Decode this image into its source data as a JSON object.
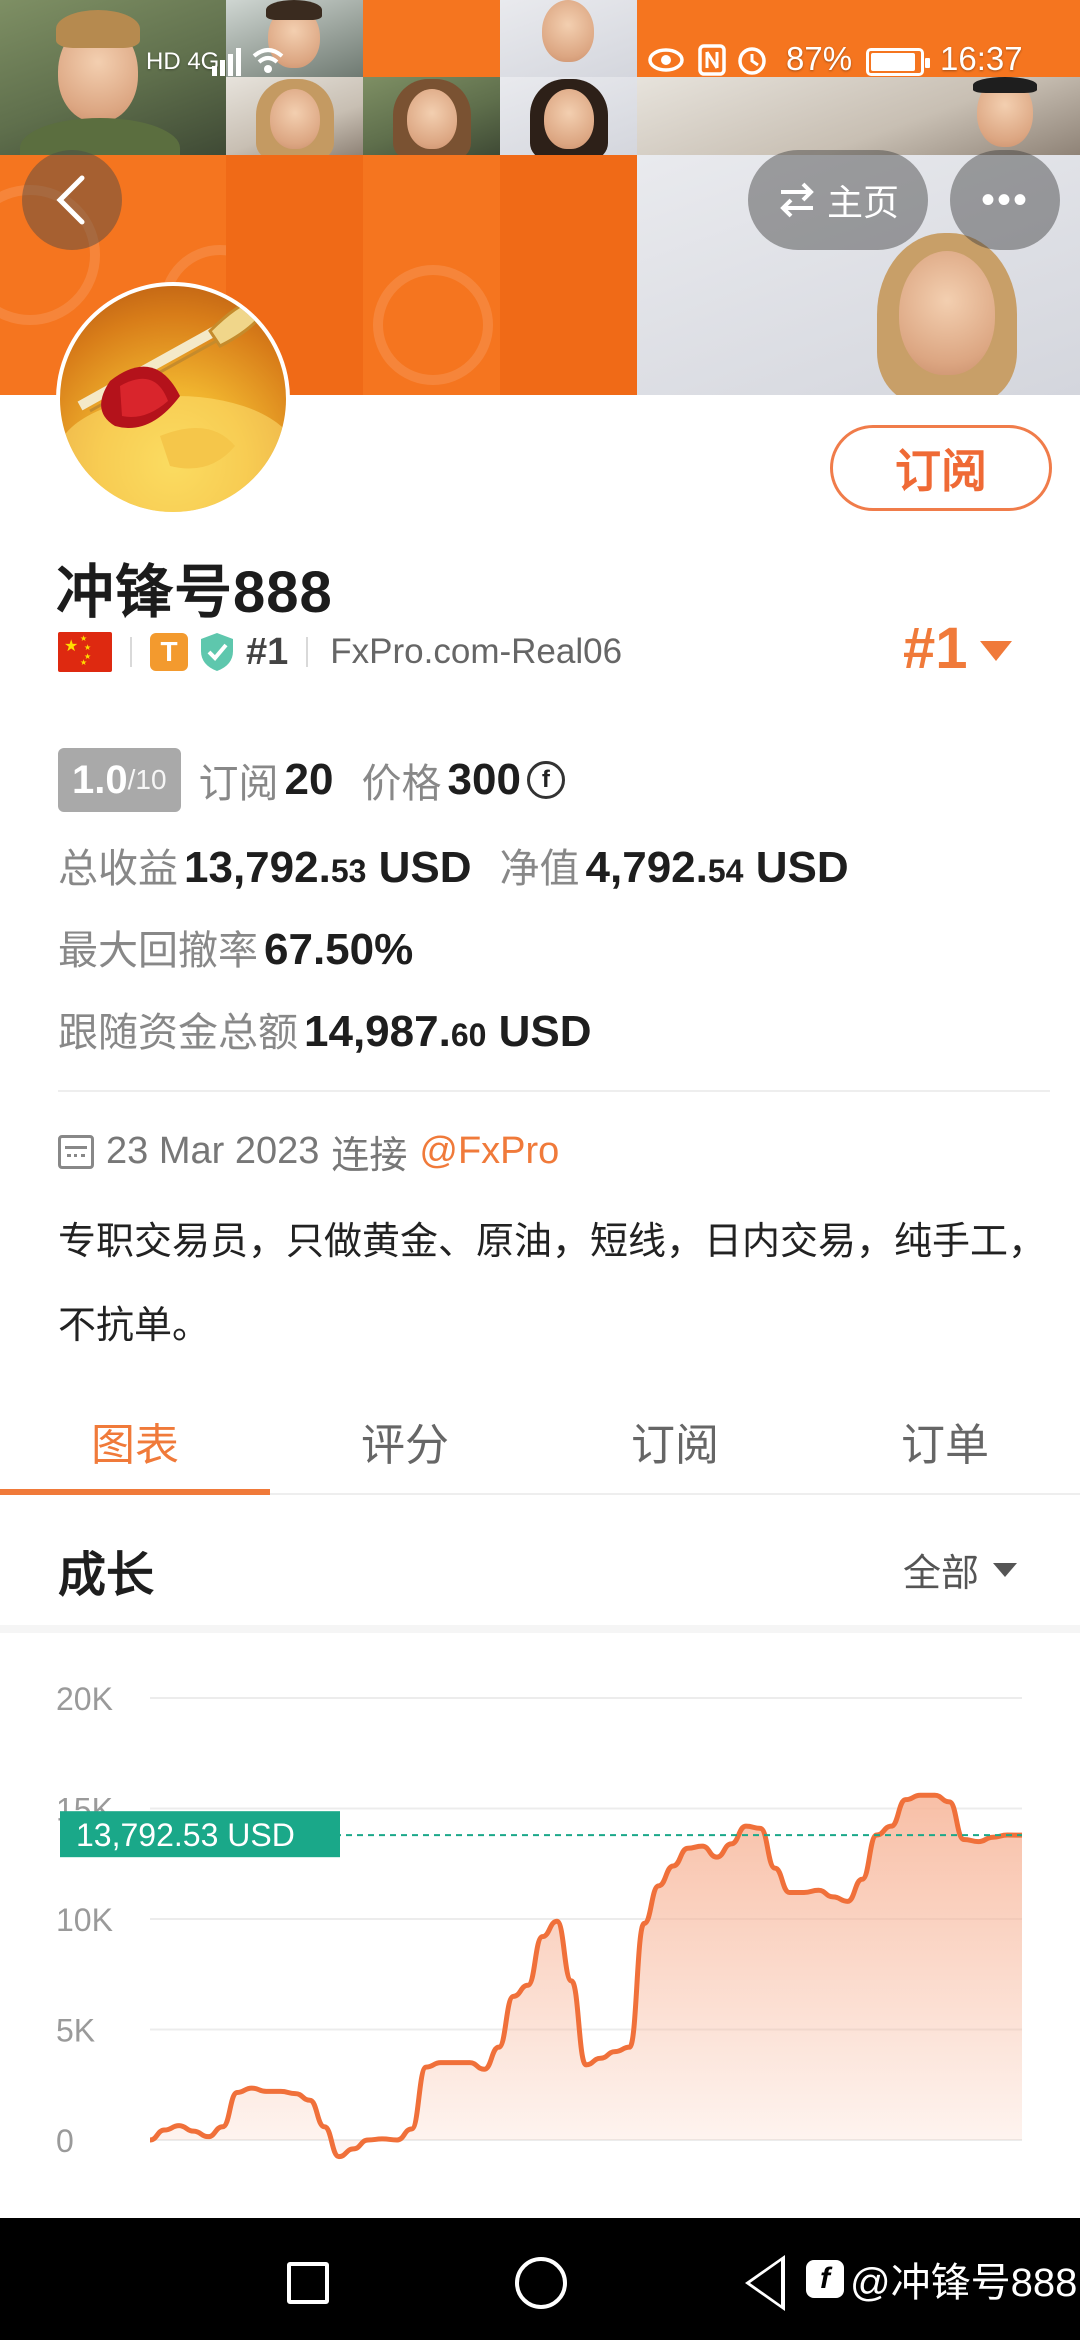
{
  "status_bar": {
    "left_icons": "HD 4G",
    "battery": "87%",
    "time": "16:37"
  },
  "header": {
    "back_icon": "chevron-left-icon",
    "home_label": "主页",
    "home_icon": "swap-icon",
    "more_label": "•••"
  },
  "profile": {
    "name": "冲锋号888",
    "subscribe_label": "订阅",
    "badge_t": "T",
    "rank_small": "#1",
    "server": "FxPro.com-Real06",
    "rank_big": "#1"
  },
  "stats": {
    "score": "1.0",
    "score_max": "/10",
    "subs_label": "订阅",
    "subs_value": "20",
    "price_label": "价格",
    "price_value": "300",
    "coin_symbol": "f",
    "total_profit_label": "总收益",
    "total_profit_int": "13,792.",
    "total_profit_dec": "53",
    "total_profit_unit": " USD",
    "equity_label": "净值",
    "equity_int": "4,792.",
    "equity_dec": "54",
    "equity_unit": " USD",
    "drawdown_label": "最大回撤率",
    "drawdown_value": "67.50%",
    "follow_label": "跟随资金总额",
    "follow_int": "14,987.",
    "follow_dec": "60",
    "follow_unit": " USD"
  },
  "connection": {
    "date": "23 Mar 2023",
    "connect_label": "连接",
    "broker": "@FxPro"
  },
  "bio": "专职交易员，只做黄金、原油，短线，日内交易，纯手工，不抗单。",
  "tabs": [
    {
      "label": "图表"
    },
    {
      "label": "评分"
    },
    {
      "label": "订阅"
    },
    {
      "label": "订单"
    }
  ],
  "section": {
    "title": "成长",
    "range": "全部"
  },
  "chart_data": {
    "type": "area",
    "ylim": [
      0,
      20000
    ],
    "yticks": [
      "20K",
      "15K",
      "10K",
      "5K",
      "0"
    ],
    "ytick_values": [
      20000,
      15000,
      10000,
      5000,
      0
    ],
    "current_value": 13792.53,
    "current_label": "13,792.53 USD",
    "line_color": "#f0703a",
    "fill_color": "#f7b497",
    "marker_color": "#1aa889",
    "series": [
      {
        "values": [
          0,
          450,
          650,
          400,
          150,
          600,
          2150,
          2350,
          2200,
          2200,
          2100,
          1800,
          600,
          -750,
          -400,
          0,
          50,
          0,
          500,
          3300,
          3500,
          3500,
          3500,
          3200,
          4200,
          6500,
          7000,
          9200,
          9900,
          7200,
          3400,
          3700,
          4000,
          4200,
          9800,
          11500,
          12400,
          13200,
          13300,
          12800,
          13400,
          14200,
          14100,
          12300,
          11200,
          11200,
          11300,
          11000,
          10800,
          11800,
          13800,
          14200,
          15400,
          15600,
          15600,
          15300,
          13600,
          13500,
          13700,
          13800,
          13792.53
        ]
      }
    ]
  },
  "watermark": {
    "logo": "f",
    "text": "@冲锋号888"
  }
}
